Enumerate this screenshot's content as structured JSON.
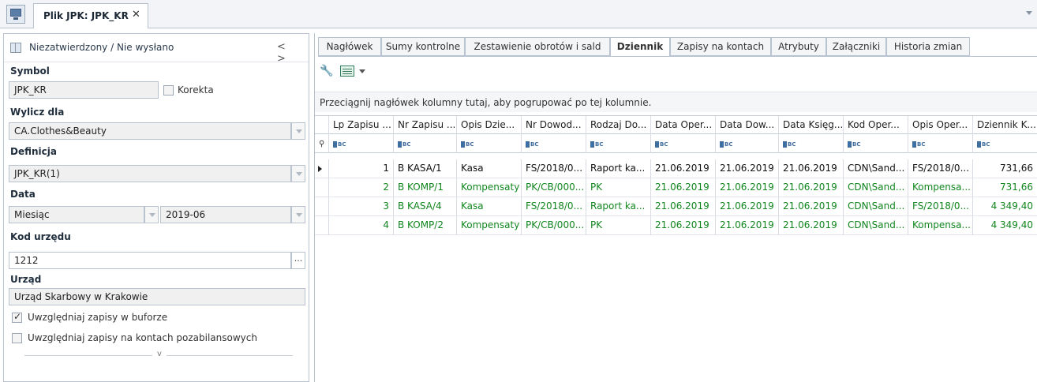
{
  "top_tab": {
    "label": "Plik JPK: JPK_KR",
    "close": "✕"
  },
  "left": {
    "status": "Niezatwierdzony / Nie wysłano",
    "nav": "< >",
    "symbol_label": "Symbol",
    "symbol_value": "JPK_KR",
    "korekta_label": "Korekta",
    "wylicz_label": "Wylicz dla",
    "wylicz_value": "CA.Clothes&Beauty",
    "definicja_label": "Definicja",
    "definicja_value": "JPK_KR(1)",
    "data_label": "Data",
    "data_period": "Miesiąc",
    "data_value": "2019-06",
    "kod_label": "Kod urzędu",
    "kod_value": "1212",
    "kod_button": "...",
    "urzad_label": "Urząd",
    "urzad_value": "Urząd Skarbowy w Krakowie",
    "chk1_label": "Uwzględniaj zapisy w buforze",
    "chk1_checked": true,
    "chk2_label": "Uwzględniaj zapisy na kontach pozabilansowych",
    "chk2_checked": false,
    "collapse_chevron": "v"
  },
  "tabs": [
    "Nagłówek",
    "Sumy kontrolne",
    "Zestawienie obrotów i sald",
    "Dziennik",
    "Zapisy na kontach",
    "Atrybuty",
    "Załączniki",
    "Historia zmian"
  ],
  "active_tab": "Dziennik",
  "toolbar": {
    "wrench_icon": "wrench-icon",
    "grid_icon": "grid-export-icon"
  },
  "group_hint": "Przeciągnij nagłówek kolumny tutaj, aby pogrupować po tej kolumnie.",
  "columns": [
    "Lp Zapisu ...",
    "Nr Zapisu ...",
    "Opis Dzie...",
    "Nr Dowod...",
    "Rodzaj Do...",
    "Data Oper...",
    "Data Dow...",
    "Data Księg...",
    "Kod Oper...",
    "Opis Oper...",
    "Dziennik K..."
  ],
  "filter_abc": "BC",
  "filter_pin": "⚲",
  "rows": [
    {
      "lp": "1",
      "nr": "B KASA/1",
      "opis": "Kasa",
      "dowod": "FS/2018/0...",
      "rodzaj": "Raport ka...",
      "d_oper": "21.06.2019",
      "d_dow": "21.06.2019",
      "d_ksieg": "21.06.2019",
      "kod": "CDN\\Sand...",
      "opis_oper": "FS/2018/0...",
      "dziennik": "731,66",
      "color": "black",
      "current": true
    },
    {
      "lp": "2",
      "nr": "B KOMP/1",
      "opis": "Kompensaty",
      "dowod": "PK/CB/000...",
      "rodzaj": "PK",
      "d_oper": "21.06.2019",
      "d_dow": "21.06.2019",
      "d_ksieg": "21.06.2019",
      "kod": "CDN\\Sand...",
      "opis_oper": "Kompensa...",
      "dziennik": "731,66",
      "color": "green",
      "current": false
    },
    {
      "lp": "3",
      "nr": "B KASA/4",
      "opis": "Kasa",
      "dowod": "FS/2018/0...",
      "rodzaj": "Raport ka...",
      "d_oper": "21.06.2019",
      "d_dow": "21.06.2019",
      "d_ksieg": "21.06.2019",
      "kod": "CDN\\Sand...",
      "opis_oper": "FS/2018/0...",
      "dziennik": "4 349,40",
      "color": "green",
      "current": false
    },
    {
      "lp": "4",
      "nr": "B KOMP/2",
      "opis": "Kompensaty",
      "dowod": "PK/CB/000...",
      "rodzaj": "PK",
      "d_oper": "21.06.2019",
      "d_dow": "21.06.2019",
      "d_ksieg": "21.06.2019",
      "kod": "CDN\\Sand...",
      "opis_oper": "Kompensa...",
      "dziennik": "4 349,40",
      "color": "green",
      "current": false
    }
  ]
}
